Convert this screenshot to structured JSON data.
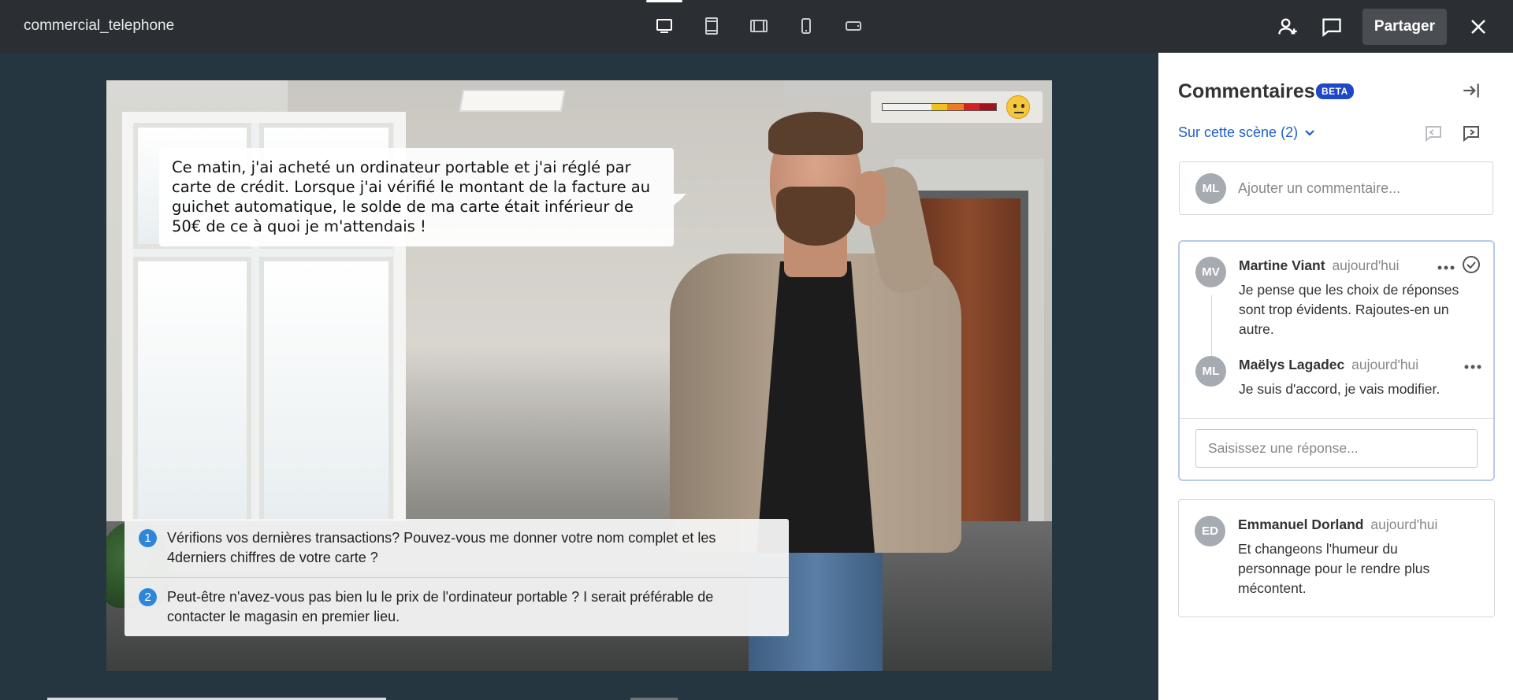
{
  "topbar": {
    "title": "commercial_telephone",
    "devices": [
      {
        "name": "desktop-icon",
        "active": true
      },
      {
        "name": "tablet-portrait-icon",
        "active": false
      },
      {
        "name": "tablet-landscape-icon",
        "active": false
      },
      {
        "name": "phone-portrait-icon",
        "active": false
      },
      {
        "name": "phone-landscape-icon",
        "active": false
      }
    ],
    "share_label": "Partager",
    "icons": [
      "add-user-icon",
      "comment-icon",
      "close-icon"
    ]
  },
  "scene": {
    "speech": "Ce matin, j'ai acheté un ordinateur portable et j'ai réglé par carte de crédit. Lorsque j'ai vérifié le montant de la facture au guichet automatique, le solde de ma carte était inférieur de 50€ de ce à quoi je m'attendais !",
    "mood": {
      "colors": [
        "#f2f2f2",
        "#f2f2f2",
        "#f2f2f2",
        "#f2c21b",
        "#ee7b22",
        "#d42020",
        "#a0141a"
      ],
      "face_icon": "neutral-face-icon"
    },
    "choices": [
      {
        "num": "1",
        "text": "Vérifions vos dernières transactions? Pouvez-vous me donner votre nom complet et les 4derniers chiffres de votre carte ?"
      },
      {
        "num": "2",
        "text": "Peut-être n'avez-vous pas bien lu le prix de l'ordinateur portable ? I serait préférable de contacter le magasin en premier lieu."
      }
    ]
  },
  "comments": {
    "title": "Commentaires",
    "badge": "BETA",
    "filter": "Sur cette scène (2)",
    "add_avatar": "ML",
    "add_placeholder": "Ajouter un commentaire...",
    "thread": [
      {
        "avatar": "MV",
        "author": "Martine Viant",
        "time": "aujourd'hui",
        "text": "Je pense que les choix de réponses sont trop évidents. Rajoutes-en un autre."
      },
      {
        "avatar": "ML",
        "author": "Maëlys Lagadec",
        "time": "aujourd'hui",
        "text": "Je suis d'accord, je vais modifier."
      }
    ],
    "reply_placeholder": "Saisissez une réponse...",
    "second": {
      "avatar": "ED",
      "author": "Emmanuel Dorland",
      "time": "aujourd'hui",
      "text": "Et changeons l'humeur du personnage pour le rendre plus mécontent."
    }
  },
  "colors": {
    "accent": "#1f47c6",
    "link": "#1f5fcc",
    "choice_badge": "#2f86d8"
  }
}
